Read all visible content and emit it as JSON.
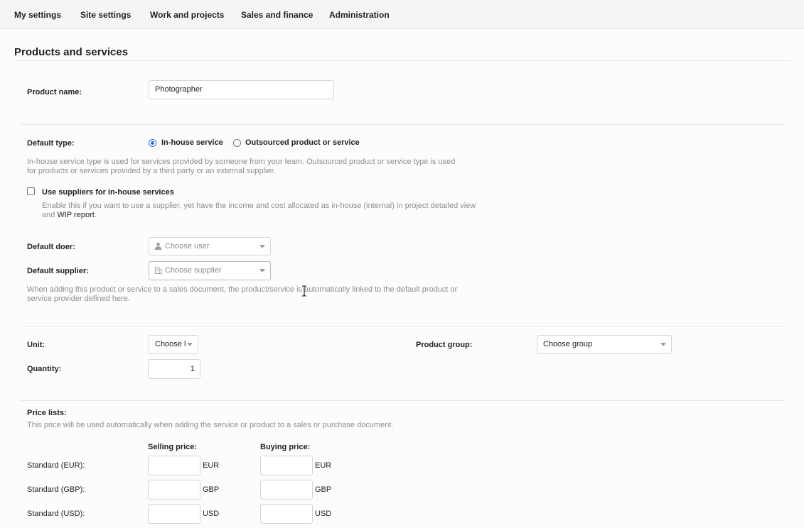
{
  "nav": {
    "items": [
      "My settings",
      "Site settings",
      "Work and projects",
      "Sales and finance",
      "Administration"
    ]
  },
  "page": {
    "title": "Products and services"
  },
  "product_name": {
    "label": "Product name:",
    "value": "Photographer"
  },
  "default_type": {
    "label": "Default type:",
    "options": [
      "In-house service",
      "Outsourced product or service"
    ],
    "selected": "In-house service",
    "help_line1": "In-house service type is used for services provided by someone from your team. Outsourced product or service type is used",
    "help_line2": "for products or services provided by a third party or an external supplier."
  },
  "use_suppliers": {
    "label": "Use suppliers for in-house services",
    "checked": false,
    "help_line1": "Enable this if you want to use a supplier, yet have the income and cost allocated as in-house (internal) in project detailed view",
    "help_line2_prefix": "and ",
    "help_link": "WIP report",
    "help_line2_suffix": "."
  },
  "default_doer": {
    "label": "Default doer:",
    "placeholder": "Choose user",
    "icon": "user-icon"
  },
  "default_supplier": {
    "label": "Default supplier:",
    "placeholder": "Choose supplier",
    "icon": "building-icon",
    "help_line1": "When adding this product or service to a sales document, the product/service is automatically linked to the default product or",
    "help_line2": "service provider defined here."
  },
  "unit": {
    "label": "Unit:",
    "placeholder": "Choose l"
  },
  "product_group": {
    "label": "Product group:",
    "placeholder": "Choose group"
  },
  "quantity": {
    "label": "Quantity:",
    "value": "1"
  },
  "price_lists": {
    "label": "Price lists:",
    "help": "This price will be used automatically when adding the service or product to a sales or purchase document.",
    "selling_header": "Selling price:",
    "buying_header": "Buying price:",
    "rows": [
      {
        "name": "Standard (EUR):",
        "currency": "EUR"
      },
      {
        "name": "Standard (GBP):",
        "currency": "GBP"
      },
      {
        "name": "Standard (USD):",
        "currency": "USD"
      }
    ]
  },
  "colors": {
    "accent": "#2b6fd6",
    "muted": "#8a8d92",
    "border": "#d3d6da"
  }
}
